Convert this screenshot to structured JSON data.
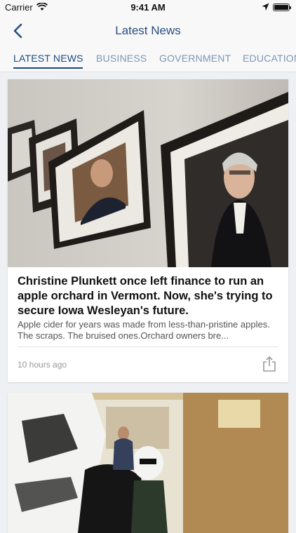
{
  "status_bar": {
    "carrier": "Carrier",
    "time": "9:41 AM"
  },
  "nav": {
    "title": "Latest News",
    "back_icon": "chevron-left-icon"
  },
  "tabs": [
    {
      "label": "LATEST NEWS",
      "active": true
    },
    {
      "label": "BUSINESS",
      "active": false
    },
    {
      "label": "GOVERNMENT",
      "active": false
    },
    {
      "label": "EDUCATION",
      "active": false
    }
  ],
  "articles": [
    {
      "headline": "Christine Plunkett once left finance to run an apple orchard in Vermont. Now, she's trying to secure Iowa Wesleyan's future.",
      "summary": "Apple cider for years was made from less-than-pristine apples. The scraps. The bruised ones.Orchard owners bre...",
      "timestamp": "10 hours ago",
      "share_icon": "share-icon"
    },
    {
      "headline": "",
      "summary": "",
      "timestamp": ""
    }
  ],
  "colors": {
    "accent": "#1d4a7f",
    "tab_inactive": "#7f96b4",
    "background": "#eef0f3"
  }
}
